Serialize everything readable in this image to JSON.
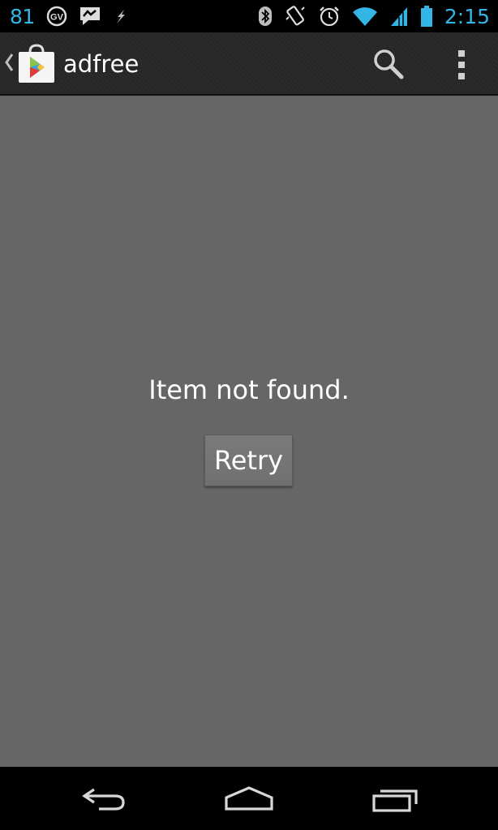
{
  "status_bar": {
    "notification_count": "81",
    "time": "2:15",
    "colors": {
      "accent": "#33b5e5",
      "background": "#000000"
    },
    "icons": [
      "gv-icon",
      "messenger-icon",
      "misc-notification-icon",
      "bluetooth-icon",
      "vibrate-icon",
      "alarm-icon",
      "wifi-icon",
      "signal-icon",
      "battery-icon"
    ]
  },
  "action_bar": {
    "title": "adfree",
    "icons": [
      "up-caret-icon",
      "play-store-icon",
      "search-icon",
      "overflow-menu-icon"
    ]
  },
  "main": {
    "message": "Item not found.",
    "retry_label": "Retry",
    "background": "#666666"
  },
  "nav_bar": {
    "icons": [
      "back-icon",
      "home-icon",
      "recent-apps-icon"
    ]
  }
}
